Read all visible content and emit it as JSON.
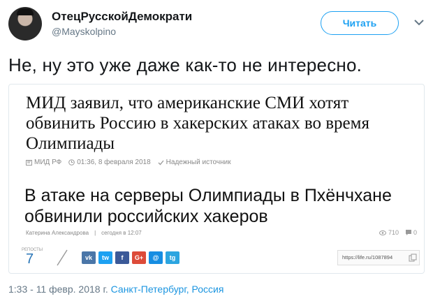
{
  "user": {
    "name": "ОтецРусскойДемократи",
    "handle": "@Mayskolpino"
  },
  "follow_label": "Читать",
  "tweet_text": "Не, ну это уже даже как-то не интересно.",
  "card": {
    "headline1": "МИД заявил, что американские СМИ хотят обвинить Россию в хакерских атаках во время Олимпиады",
    "meta1": {
      "source": "МИД РФ",
      "time": "01:36, 8 февраля 2018",
      "reliability": "Надежный источник"
    },
    "headline2": "В атаке на серверы Олимпиады в Пхёнчхане обвинили российских хакеров",
    "meta2": {
      "author": "Катерина Александрова",
      "time": "сегодня в 12:07"
    },
    "stats": {
      "views": "710",
      "comments": "0"
    },
    "reposts_label": "РЕПОСТЫ",
    "reposts_count": "7",
    "share_buttons": [
      {
        "label": "vk",
        "color": "#4a76a8"
      },
      {
        "label": "tw",
        "color": "#1da1f2"
      },
      {
        "label": "f",
        "color": "#3b5998"
      },
      {
        "label": "G+",
        "color": "#dd4b39"
      },
      {
        "label": "@",
        "color": "#168de2"
      },
      {
        "label": "tg",
        "color": "#2ca5e0"
      }
    ],
    "url": "https://life.ru/1087894"
  },
  "footer": {
    "datetime": "1:33 - 11 февр. 2018 г.",
    "location": "Санкт-Петербург, Россия"
  }
}
